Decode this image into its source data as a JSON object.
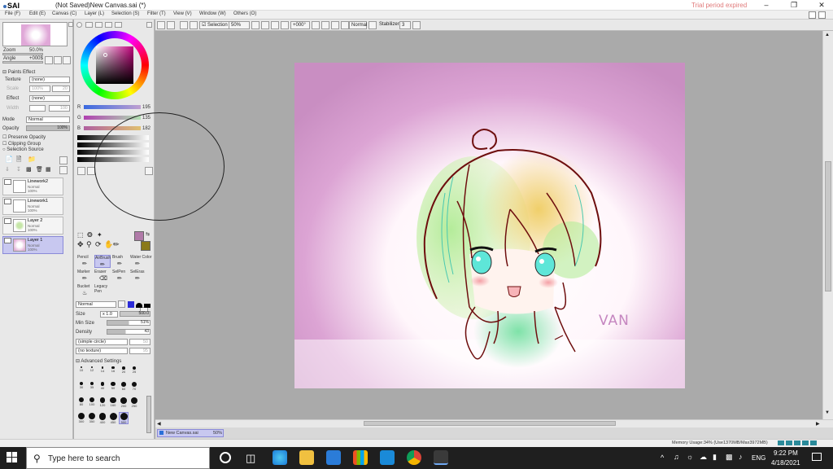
{
  "app": {
    "logo_text": "SAI",
    "window_title": "(Not Saved)New Canvas.sai (*)",
    "trial_notice": "Trial period expired"
  },
  "menu": [
    "File (F)",
    "Edit (E)",
    "Canvas (C)",
    "Layer (L)",
    "Selection (S)",
    "Filter (T)",
    "View (V)",
    "Window (W)",
    "Others (O)"
  ],
  "toolbar": {
    "selection_label": "Selection",
    "zoom_value": "50%",
    "rotation_value": "+000°",
    "blend_mode": "Normal",
    "stabilizer_label": "Stabilizer",
    "stabilizer_value": "3"
  },
  "navigator": {
    "zoom_label": "Zoom",
    "zoom_value": "50.0%",
    "angle_label": "Angle",
    "angle_value": "+000$"
  },
  "paint_effect": {
    "header": "Paints Effect",
    "texture_label": "Texture",
    "texture_value": "(none)",
    "scale_label": "Scale",
    "scale_value": "100%",
    "scale_num": "20",
    "effect_label": "Effect",
    "effect_value": "(none)",
    "width_label": "Width",
    "width_num": "100"
  },
  "layer_props": {
    "mode_label": "Mode",
    "mode_value": "Normal",
    "opacity_label": "Opacity",
    "opacity_value": "100%",
    "checks": [
      "Preserve Opacity",
      "Clipping Group",
      "Selection Source"
    ]
  },
  "layers": [
    {
      "name": "Linework2",
      "mode": "Normal",
      "opacity": "100%",
      "selected": false
    },
    {
      "name": "Linework1",
      "mode": "Normal",
      "opacity": "100%",
      "selected": false
    },
    {
      "name": "Layer 2",
      "mode": "Normal",
      "opacity": "100%",
      "selected": false
    },
    {
      "name": "Layer 1",
      "mode": "Normal",
      "opacity": "100%",
      "selected": true
    }
  ],
  "color": {
    "r_label": "R",
    "r_value": "195",
    "g_label": "G",
    "g_value": "135",
    "b_label": "B",
    "b_value": "182",
    "primary": "#b07aa8",
    "secondary": "#8a7a1a"
  },
  "tools": {
    "row1": [
      "Pencil",
      "AirBrush",
      "Brush",
      "Water Color"
    ],
    "row2": [
      "Marker",
      "Eraser",
      "SelPen",
      "SelEras"
    ],
    "row3": [
      "Bucket",
      "Legacy Pen"
    ]
  },
  "brush": {
    "blend_mode": "Normal",
    "size_label": "Size",
    "size_mult": "x 1.0",
    "size_value": "500.0",
    "min_size_label": "Min Size",
    "min_size_value": "51%",
    "density_label": "Density",
    "density_value": "43",
    "shape_value": "(simple circle)",
    "shape_num": "50",
    "texture_value": "(no texture)",
    "texture_num": "95",
    "advanced_label": "Advanced Settings",
    "presets": [
      "10",
      "12",
      "14",
      "16",
      "20",
      "25",
      "30",
      "35",
      "40",
      "50",
      "60",
      "70",
      "80",
      "100",
      "120",
      "160",
      "200",
      "250",
      "300",
      "350",
      "400",
      "450",
      "500"
    ]
  },
  "canvas": {
    "signature": "VAN"
  },
  "doc_tab": {
    "name": "New Canvas.sai",
    "zoom": "50%"
  },
  "status": {
    "memory": "Memory Usage:34% (Use1370MB/Max3972MB)"
  },
  "taskbar": {
    "search_placeholder": "Type here to search",
    "language": "ENG",
    "time": "9:22 PM",
    "date": "4/18/2021"
  }
}
